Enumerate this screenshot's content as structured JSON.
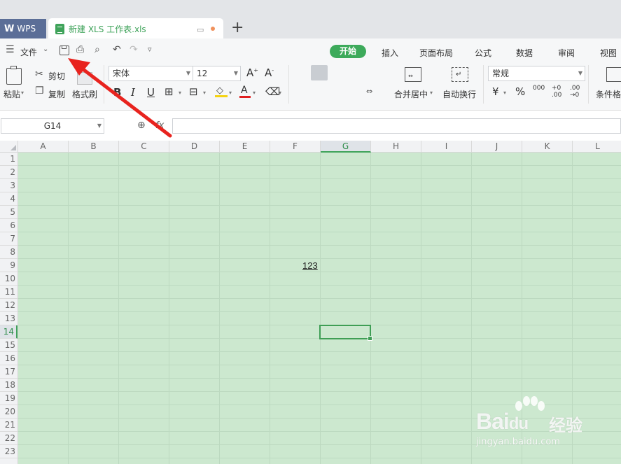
{
  "tabs": {
    "wps_label": "WPS",
    "doc_title": "新建 XLS 工作表.xls",
    "add_label": "+"
  },
  "quick_access": {
    "menu_label": "文件"
  },
  "ribbon_tabs": [
    "开始",
    "插入",
    "页面布局",
    "公式",
    "数据",
    "审阅",
    "视图"
  ],
  "clipboard": {
    "paste": "粘贴",
    "cut": "剪切",
    "copy": "复制",
    "format_painter": "格式刷"
  },
  "font": {
    "name": "宋体",
    "size": "12"
  },
  "alignment": {
    "merge_center": "合并居中",
    "wrap_text": "自动换行"
  },
  "number": {
    "format": "常规",
    "percent": "%",
    "thousands": "000",
    "inc_decimal": "+0 .00",
    "dec_decimal": ".00 →0"
  },
  "styles": {
    "conditional": "条件格"
  },
  "formula_bar": {
    "name_box": "G14",
    "fx": "fx",
    "value": ""
  },
  "sheet": {
    "columns": [
      "A",
      "B",
      "C",
      "D",
      "E",
      "F",
      "G",
      "H",
      "I",
      "J",
      "K",
      "L"
    ],
    "active_column": "G",
    "rows": [
      "1",
      "2",
      "3",
      "4",
      "5",
      "6",
      "7",
      "8",
      "9",
      "10",
      "11",
      "12",
      "13",
      "14",
      "15",
      "16",
      "17",
      "18",
      "19",
      "20",
      "21",
      "22",
      "23"
    ],
    "active_row": "14",
    "cells": {
      "G9": "123"
    },
    "grid_color": "#cce8cf"
  },
  "watermark": {
    "brand": "Bai",
    "brand_suffix": "du",
    "cn": "经验",
    "url": "jingyan.baidu.com"
  },
  "annotation": {
    "arrow_color": "#e8231e"
  }
}
